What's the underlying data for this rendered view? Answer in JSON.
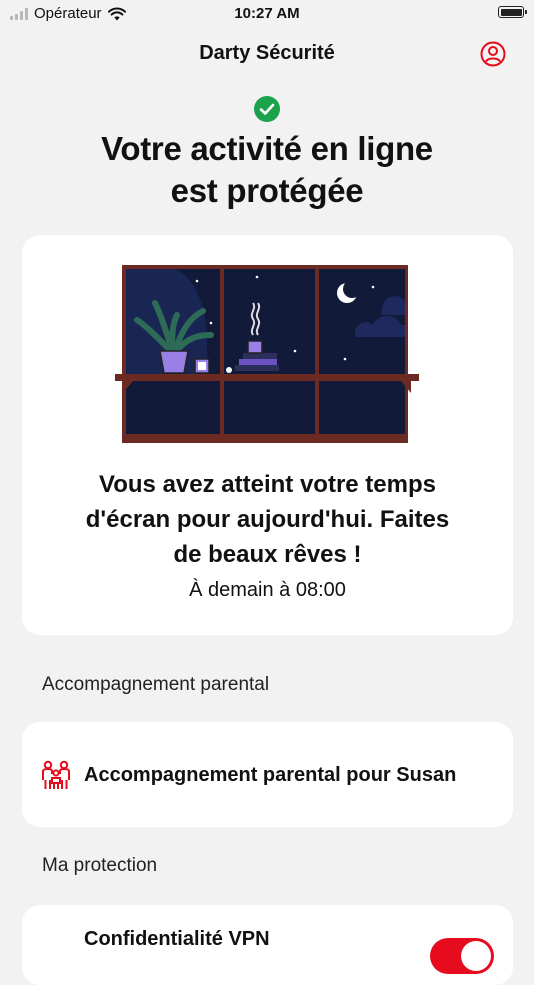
{
  "status_bar": {
    "carrier": "Opérateur",
    "time": "10:27 AM"
  },
  "nav": {
    "title": "Darty Sécurité",
    "profile_icon": "user-circle-icon"
  },
  "hero": {
    "status_icon": "check-circle-icon",
    "title_line1": "Votre activité en ligne",
    "title_line2": "est protégée"
  },
  "screen_time_card": {
    "illustration": "night-window-illustration",
    "message_line1": "Vous avez atteint votre temps",
    "message_line2": "d'écran pour aujourd'hui. Faites",
    "message_line3": "de beaux rêves !",
    "resume_text": "À demain à 08:00"
  },
  "parental_section": {
    "label": "Accompagnement parental",
    "item_icon": "family-icon",
    "item_label": "Accompagnement parental pour Susan"
  },
  "protection_section": {
    "label": "Ma protection",
    "vpn_label": "Confidentialité VPN",
    "vpn_enabled": true
  },
  "colors": {
    "accent": "#e60c1d",
    "success": "#1aa34a",
    "background": "#f2f2f2",
    "card": "#ffffff",
    "night_sky": "#121a3a",
    "window_frame": "#6b2b22"
  }
}
